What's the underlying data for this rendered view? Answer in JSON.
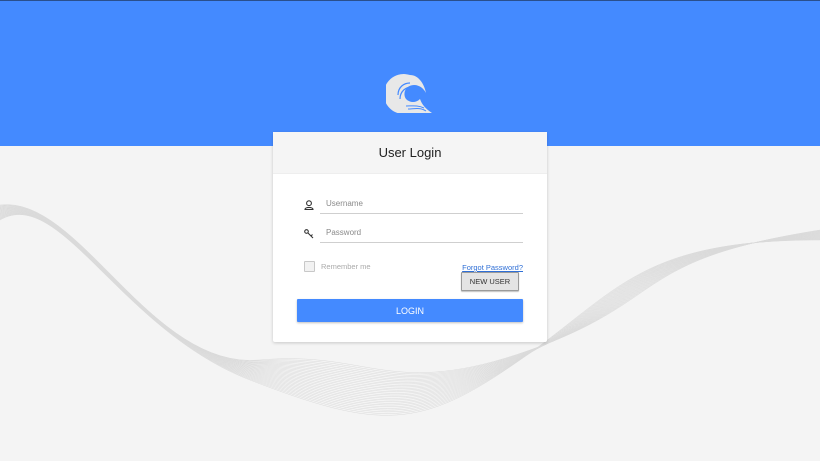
{
  "login": {
    "title": "User Login",
    "username_placeholder": "Username",
    "password_placeholder": "Password",
    "remember_label": "Remember me",
    "forgot_label": "Forgot Password?",
    "new_user_label": "NEW USER",
    "login_label": "LOGIN"
  },
  "icons": {
    "logo": "wave-logo-icon",
    "username": "user-icon",
    "password": "key-icon"
  },
  "colors": {
    "header": "#448aff",
    "background": "#f4f4f4",
    "button": "#448aff",
    "link": "#2f6fd6"
  }
}
